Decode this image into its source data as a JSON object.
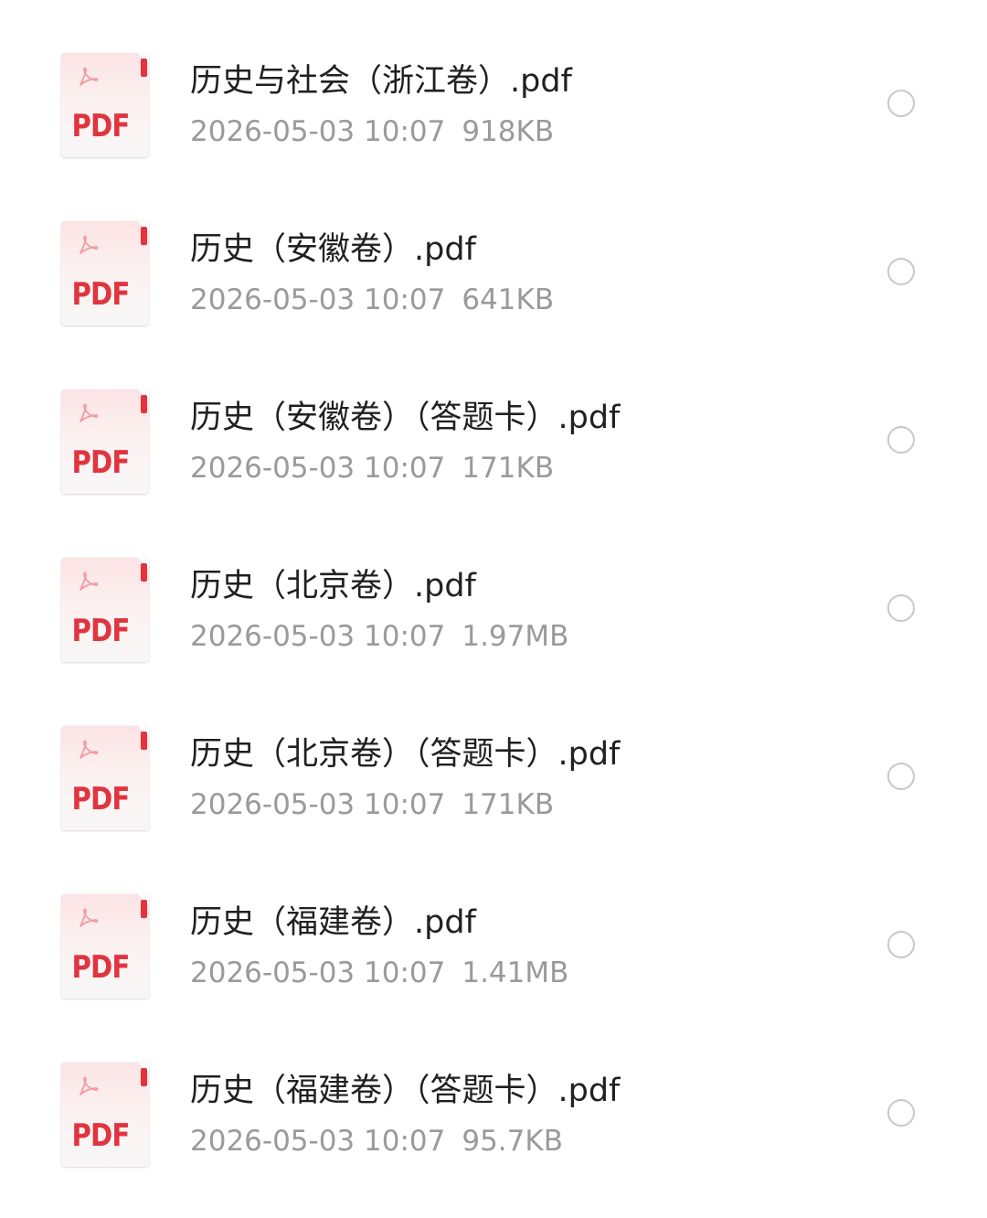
{
  "colors": {
    "pdf_red": "#e03540",
    "title_text": "#202020",
    "meta_text": "#9a9a9a",
    "radio_border": "#c8c8c8"
  },
  "icons": {
    "file_type_icon": "pdf-file-icon",
    "file_type_label": "PDF",
    "select_icon": "radio-unchecked-icon"
  },
  "files": [
    {
      "name": "历史与社会（浙江卷）.pdf",
      "date": "2026-05-03 10:07",
      "size": "918KB",
      "selected": false
    },
    {
      "name": "历史（安徽卷）.pdf",
      "date": "2026-05-03 10:07",
      "size": "641KB",
      "selected": false
    },
    {
      "name": "历史（安徽卷）（答题卡）.pdf",
      "date": "2026-05-03 10:07",
      "size": "171KB",
      "selected": false
    },
    {
      "name": "历史（北京卷）.pdf",
      "date": "2026-05-03 10:07",
      "size": "1.97MB",
      "selected": false
    },
    {
      "name": "历史（北京卷）（答题卡）.pdf",
      "date": "2026-05-03 10:07",
      "size": "171KB",
      "selected": false
    },
    {
      "name": "历史（福建卷）.pdf",
      "date": "2026-05-03 10:07",
      "size": "1.41MB",
      "selected": false
    },
    {
      "name": "历史（福建卷）（答题卡）.pdf",
      "date": "2026-05-03 10:07",
      "size": "95.7KB",
      "selected": false
    }
  ]
}
